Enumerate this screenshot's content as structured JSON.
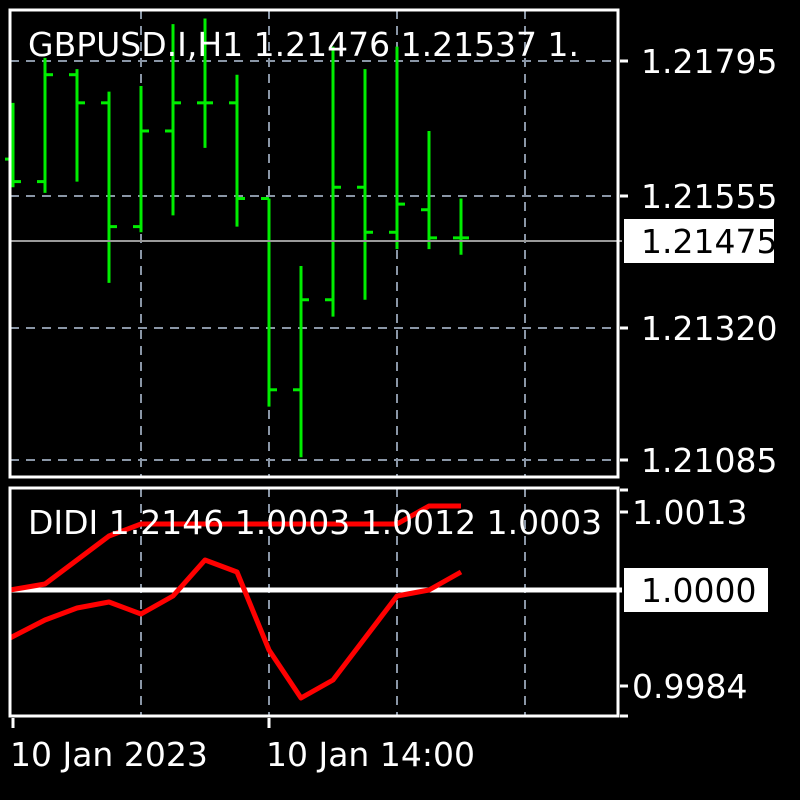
{
  "colors": {
    "background": "#000000",
    "frame": "#ffffff",
    "grid": "#8a96a6",
    "bars": "#00ee00",
    "price_line": "#9a9a9a",
    "indicator": "#ff0000",
    "indicator_level": "#ffffff"
  },
  "main": {
    "header": "GBPUSD.I,H1  1.21476 1.21537 1.",
    "current_price_label": "1.21475"
  },
  "indicator": {
    "header": "DIDI 1.2146 1.0003 1.0012 1.0003",
    "level_label": "1.0000"
  },
  "chart_data": [
    {
      "type": "ohlc",
      "symbol": "GBPUSD.I",
      "timeframe": "H1",
      "y_ticks": [
        1.21795,
        1.21555,
        1.2132,
        1.21085
      ],
      "y_tick_labels": [
        "1.21795",
        "1.21555",
        "1.21320",
        "1.21085"
      ],
      "current_price": 1.21475,
      "ylim": [
        1.21055,
        1.21885
      ],
      "x_ticks": [
        {
          "bar": 4,
          "label": "10 Jan 2023"
        },
        {
          "bar": 8,
          "label": "10 Jan 14:00"
        }
      ],
      "bars": [
        {
          "open": 1.2162,
          "high": 1.2172,
          "low": 1.2157,
          "close": 1.2158
        },
        {
          "open": 1.2158,
          "high": 1.218,
          "low": 1.2156,
          "close": 1.2177
        },
        {
          "open": 1.2177,
          "high": 1.2178,
          "low": 1.2158,
          "close": 1.2172
        },
        {
          "open": 1.2172,
          "high": 1.2174,
          "low": 1.214,
          "close": 1.215
        },
        {
          "open": 1.215,
          "high": 1.2175,
          "low": 1.2149,
          "close": 1.2167
        },
        {
          "open": 1.2167,
          "high": 1.2186,
          "low": 1.2152,
          "close": 1.2172
        },
        {
          "open": 1.2172,
          "high": 1.2187,
          "low": 1.2164,
          "close": 1.2172
        },
        {
          "open": 1.2172,
          "high": 1.2177,
          "low": 1.215,
          "close": 1.2155
        },
        {
          "open": 1.2155,
          "high": 1.2155,
          "low": 1.2118,
          "close": 1.2121
        },
        {
          "open": 1.2121,
          "high": 1.2143,
          "low": 1.2109,
          "close": 1.2137
        },
        {
          "open": 1.2137,
          "high": 1.2182,
          "low": 1.2134,
          "close": 1.2157
        },
        {
          "open": 1.2157,
          "high": 1.2178,
          "low": 1.2137,
          "close": 1.2149
        },
        {
          "open": 1.2149,
          "high": 1.2182,
          "low": 1.2146,
          "close": 1.2154
        },
        {
          "open": 1.2153,
          "high": 1.2167,
          "low": 1.2146,
          "close": 1.2148
        },
        {
          "open": 1.2148,
          "high": 1.2155,
          "low": 1.2145,
          "close": 1.2148
        }
      ]
    },
    {
      "type": "line",
      "name": "DIDI",
      "y_ticks": [
        1.0013,
        0.9984
      ],
      "y_tick_labels": [
        "1.0013",
        "0.9984"
      ],
      "level": 1.0,
      "ylim": [
        0.9979,
        1.0017
      ],
      "series": [
        {
          "values": [
            1.0,
            1.0001,
            1.0005,
            1.0009,
            1.0011,
            1.0011,
            1.0011,
            1.0011,
            1.0011,
            1.0011,
            1.0011,
            1.0011,
            1.0011,
            1.0014,
            1.0014
          ]
        },
        {
          "values": [
            0.9992,
            0.9995,
            0.9997,
            0.9998,
            0.9996,
            0.9999,
            1.0005,
            1.0003,
            0.999,
            0.9982,
            0.9985,
            0.9992,
            0.9999,
            1.0,
            1.0003
          ]
        }
      ]
    }
  ]
}
